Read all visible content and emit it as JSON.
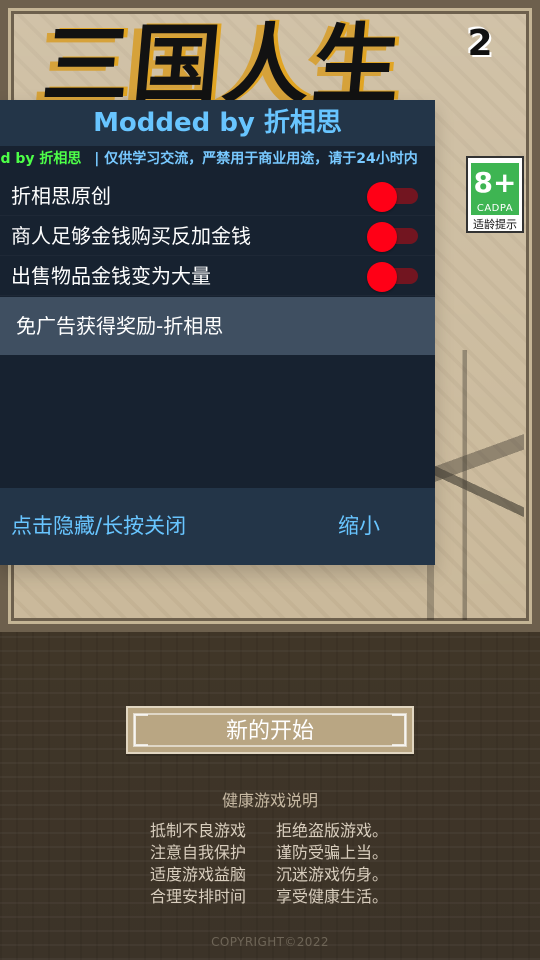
{
  "game": {
    "title": "三国人生",
    "title_number": "2",
    "age_rating": {
      "rating": "8+",
      "org": "CADPA",
      "label": "适龄提示"
    },
    "start_button": "新的开始",
    "health": {
      "title": "健康游戏说明",
      "rows": [
        [
          "抵制不良游戏",
          "拒绝盗版游戏。"
        ],
        [
          "注意自我保护",
          "谨防受骗上当。"
        ],
        [
          "适度游戏益脑",
          "沉迷游戏伤身。"
        ],
        [
          "合理安排时间",
          "享受健康生活。"
        ]
      ]
    },
    "copyright": "COPYRIGHT©2022"
  },
  "mod_menu": {
    "title": "Modded by 折相思",
    "notice_author": "ed by 折相思",
    "notice_text": "| 仅供学习交流，严禁用于商业用途，请于24小时内",
    "options": [
      {
        "label": "折相思原创",
        "state": "on"
      },
      {
        "label": "商人足够金钱购买反加金钱",
        "state": "on"
      },
      {
        "label": "出售物品金钱变为大量",
        "state": "on"
      }
    ],
    "reward_button": "免广告获得奖励-折相思",
    "footer": {
      "hide_close": "点击隐藏/长按关闭",
      "shrink": "缩小"
    }
  },
  "colors": {
    "panel_dark": "#172230",
    "panel_header": "#233548",
    "accent_blue": "#68c5ff",
    "notice_green": "#4dff48",
    "toggle_red": "#ff0016",
    "age_green": "#3eb552"
  }
}
